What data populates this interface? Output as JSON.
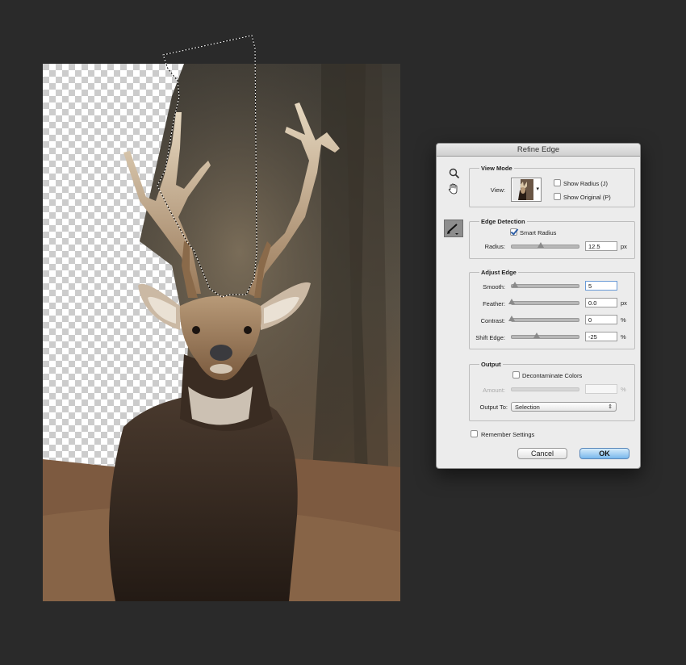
{
  "dialog": {
    "title": "Refine Edge",
    "tools": {
      "zoom": "zoom-icon",
      "hand": "hand-icon",
      "refine_brush": "refine-radius-brush-icon"
    },
    "view_mode": {
      "legend": "View Mode",
      "view_label": "View:",
      "show_radius_label": "Show Radius (J)",
      "show_radius_checked": false,
      "show_original_label": "Show Original (P)",
      "show_original_checked": false
    },
    "edge_detection": {
      "legend": "Edge Detection",
      "smart_radius_label": "Smart Radius",
      "smart_radius_checked": true,
      "radius_label": "Radius:",
      "radius_value": "12.5",
      "radius_unit": "px"
    },
    "adjust_edge": {
      "legend": "Adjust Edge",
      "smooth_label": "Smooth:",
      "smooth_value": "5",
      "feather_label": "Feather:",
      "feather_value": "0.0",
      "feather_unit": "px",
      "contrast_label": "Contrast:",
      "contrast_value": "0",
      "contrast_unit": "%",
      "shift_label": "Shift Edge:",
      "shift_value": "-25",
      "shift_unit": "%"
    },
    "output": {
      "legend": "Output",
      "decontaminate_label": "Decontaminate Colors",
      "decontaminate_checked": false,
      "amount_label": "Amount:",
      "amount_value": "",
      "amount_unit": "%",
      "output_to_label": "Output To:",
      "output_to_value": "Selection"
    },
    "remember_label": "Remember Settings",
    "remember_checked": false,
    "cancel_label": "Cancel",
    "ok_label": "OK"
  },
  "colors": {
    "app_background": "#2a2a2a",
    "dialog_background": "#ececec",
    "ok_button": "#78b8ec",
    "checkbox_accent": "#2f5fa7"
  }
}
